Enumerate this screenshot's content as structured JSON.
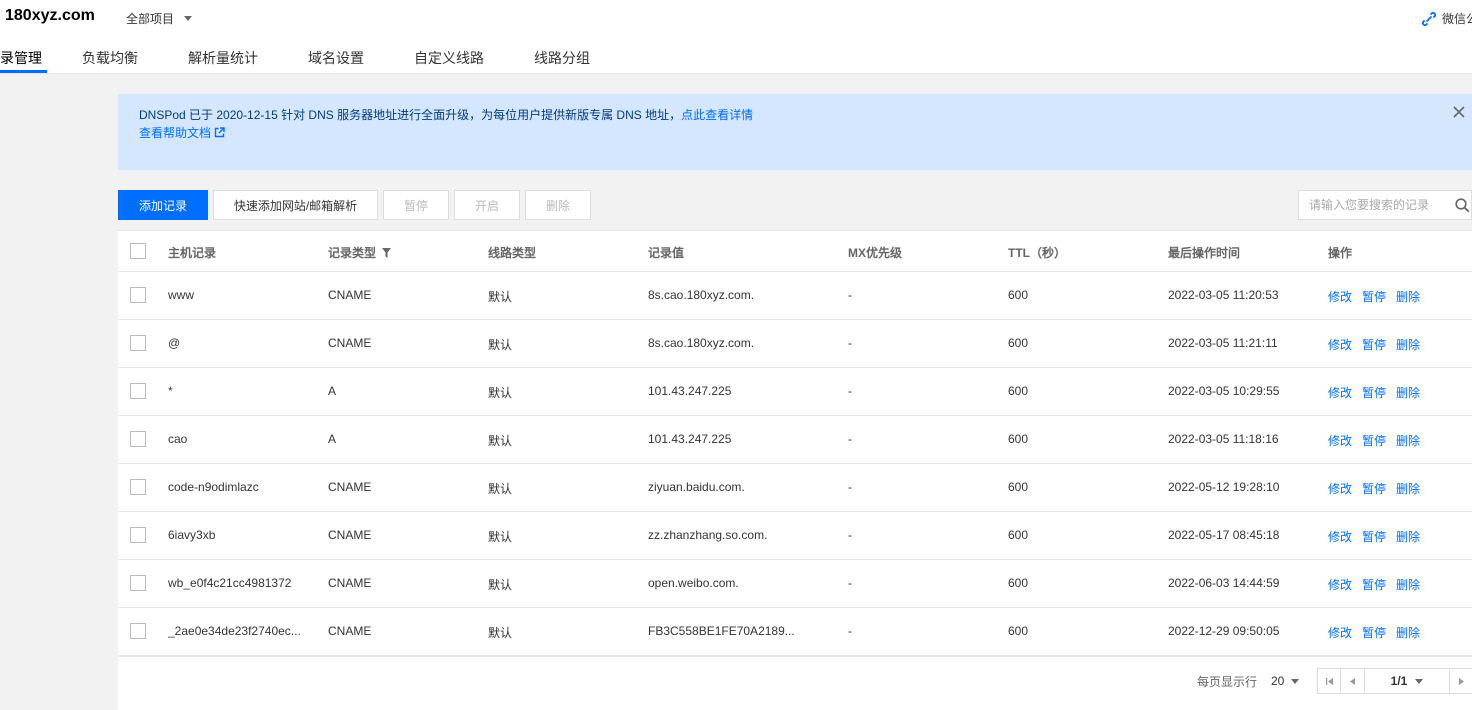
{
  "header": {
    "domain": "180xyz.com",
    "project_selector": "全部项目",
    "wechat_label": "微信公"
  },
  "tabs": [
    {
      "label": "录管理",
      "active": true
    },
    {
      "label": "负载均衡"
    },
    {
      "label": "解析量统计"
    },
    {
      "label": "域名设置"
    },
    {
      "label": "自定义线路"
    },
    {
      "label": "线路分组"
    }
  ],
  "banner": {
    "message": "DNSPod 已于 2020-12-15 针对 DNS 服务器地址进行全面升级，为每位用户提供新版专属 DNS 地址，",
    "detail_link": "点此查看详情",
    "help_link": "查看帮助文档"
  },
  "toolbar": {
    "add_record": "添加记录",
    "quick_add": "快速添加网站/邮箱解析",
    "pause": "暂停",
    "enable": "开启",
    "delete": "删除",
    "search_placeholder": "请输入您要搜索的记录"
  },
  "table": {
    "columns": {
      "host": "主机记录",
      "type": "记录类型",
      "line": "线路类型",
      "value": "记录值",
      "mx": "MX优先级",
      "ttl": "TTL（秒）",
      "time": "最后操作时间",
      "actions": "操作"
    },
    "action_labels": {
      "edit": "修改",
      "pause": "暂停",
      "delete": "删除"
    },
    "rows": [
      {
        "host": "www",
        "type": "CNAME",
        "line": "默认",
        "value": "8s.cao.180xyz.com.",
        "mx": "-",
        "ttl": "600",
        "time": "2022-03-05 11:20:53"
      },
      {
        "host": "@",
        "type": "CNAME",
        "line": "默认",
        "value": "8s.cao.180xyz.com.",
        "mx": "-",
        "ttl": "600",
        "time": "2022-03-05 11:21:11"
      },
      {
        "host": "*",
        "type": "A",
        "line": "默认",
        "value": "101.43.247.225",
        "mx": "-",
        "ttl": "600",
        "time": "2022-03-05 10:29:55"
      },
      {
        "host": "cao",
        "type": "A",
        "line": "默认",
        "value": "101.43.247.225",
        "mx": "-",
        "ttl": "600",
        "time": "2022-03-05 11:18:16"
      },
      {
        "host": "code-n9odimlazc",
        "type": "CNAME",
        "line": "默认",
        "value": "ziyuan.baidu.com.",
        "mx": "-",
        "ttl": "600",
        "time": "2022-05-12 19:28:10"
      },
      {
        "host": "6iavy3xb",
        "type": "CNAME",
        "line": "默认",
        "value": "zz.zhanzhang.so.com.",
        "mx": "-",
        "ttl": "600",
        "time": "2022-05-17 08:45:18"
      },
      {
        "host": "wb_e0f4c21cc4981372",
        "type": "CNAME",
        "line": "默认",
        "value": "open.weibo.com.",
        "mx": "-",
        "ttl": "600",
        "time": "2022-06-03 14:44:59"
      },
      {
        "host": "_2ae0e34de23f2740ec...",
        "type": "CNAME",
        "line": "默认",
        "value": "FB3C558BE1FE70A2189...",
        "mx": "-",
        "ttl": "600",
        "time": "2022-12-29 09:50:05"
      }
    ]
  },
  "pagination": {
    "per_page_label": "每页显示行",
    "per_page": "20",
    "page": "1/1"
  },
  "colors": {
    "accent": "#006eff",
    "banner_bg": "#d5e7ff"
  }
}
